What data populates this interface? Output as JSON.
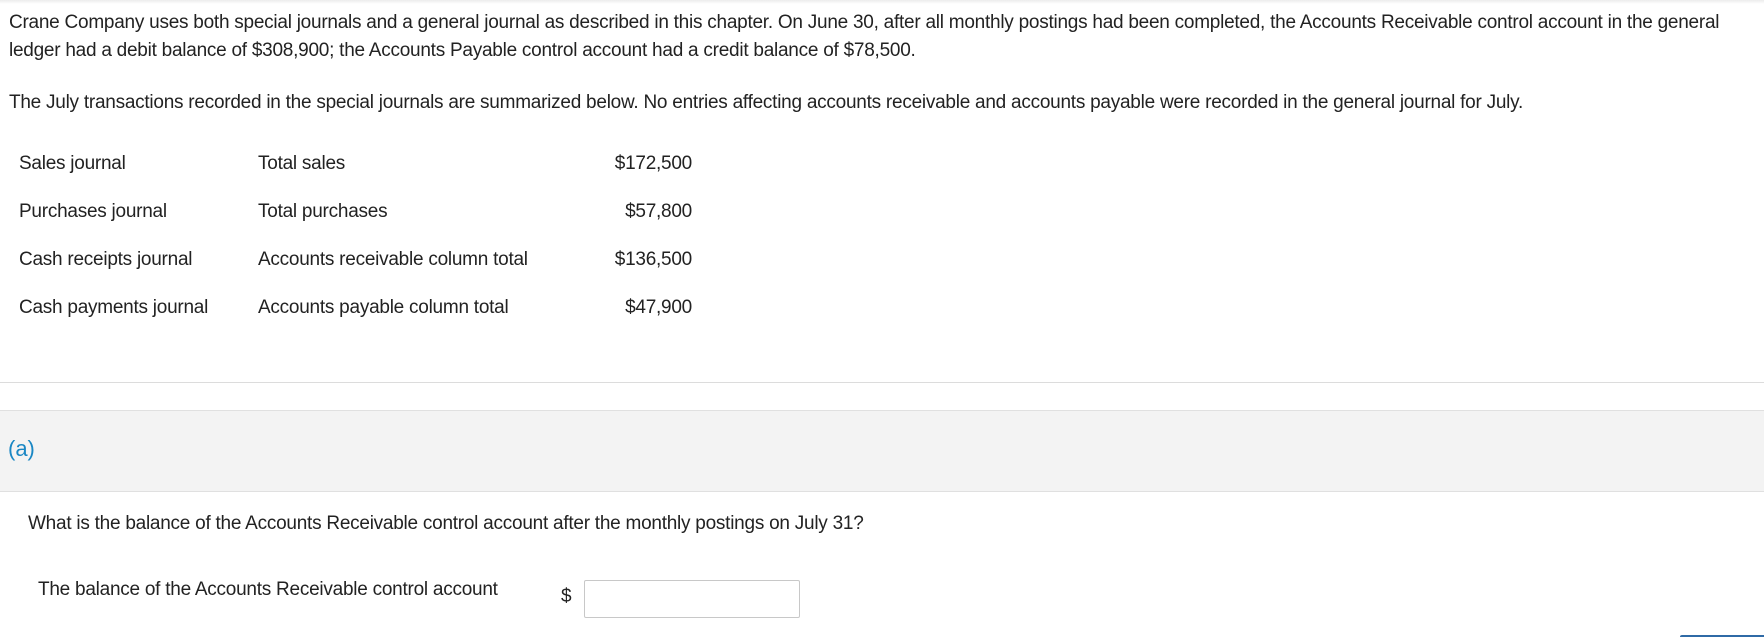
{
  "intro": {
    "paragraph1": "Crane Company uses both special journals and a general journal as described in this chapter. On June 30, after all monthly postings had been completed, the Accounts Receivable control account in the general ledger had a debit balance of $308,900; the Accounts Payable control account had a credit balance of $78,500.",
    "paragraph2": "The July transactions recorded in the special journals are summarized below. No entries affecting accounts receivable and accounts payable were recorded in the general journal for July."
  },
  "journal_table": [
    {
      "journal": "Sales journal",
      "description": "Total sales",
      "amount": "$172,500"
    },
    {
      "journal": "Purchases journal",
      "description": "Total purchases",
      "amount": "$57,800"
    },
    {
      "journal": "Cash receipts journal",
      "description": "Accounts receivable column total",
      "amount": "$136,500"
    },
    {
      "journal": "Cash payments journal",
      "description": "Accounts payable column total",
      "amount": "$47,900"
    }
  ],
  "part_a": {
    "label": "(a)",
    "question": "What is the balance of the Accounts Receivable control account after the monthly postings on July 31?",
    "answer_label": "The balance of the Accounts Receivable control account",
    "currency_symbol": "$",
    "answer_value": ""
  },
  "colors": {
    "part_label": "#1a87c4",
    "button_accent": "#2f6aa6"
  }
}
